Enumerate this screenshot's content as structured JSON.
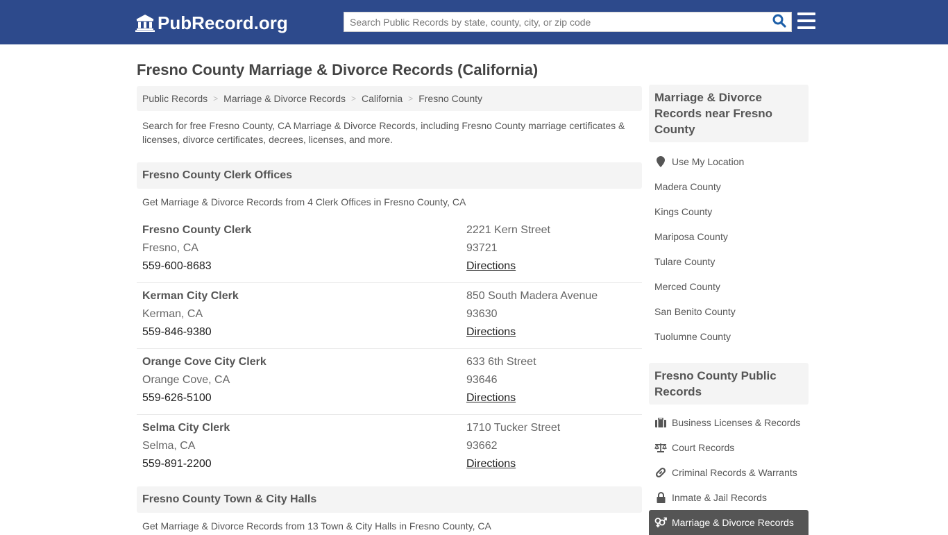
{
  "header": {
    "logo_text": "PubRecord.org",
    "search_placeholder": "Search Public Records by state, county, city, or zip code",
    "search_value": "",
    "colors": {
      "topbar": "#2d4a8c",
      "search_icon": "#1d5fa8"
    }
  },
  "page": {
    "title": "Fresno County Marriage & Divorce Records (California)",
    "breadcrumb": [
      "Public Records",
      "Marriage & Divorce Records",
      "California",
      "Fresno County"
    ],
    "breadcrumb_separator": ">",
    "intro": "Search for free Fresno County, CA Marriage & Divorce Records, including Fresno County marriage certificates & licenses, divorce certificates, decrees, licenses, and more."
  },
  "clerk_section": {
    "heading": "Fresno County Clerk Offices",
    "subheading": "Get Marriage & Divorce Records from 4 Clerk Offices in Fresno County, CA",
    "offices": [
      {
        "name": "Fresno County Clerk",
        "city": "Fresno, CA",
        "phone": "559-600-8683",
        "street": "2221 Kern Street",
        "zip": "93721",
        "directions": "Directions"
      },
      {
        "name": "Kerman City Clerk",
        "city": "Kerman, CA",
        "phone": "559-846-9380",
        "street": "850 South Madera Avenue",
        "zip": "93630",
        "directions": "Directions"
      },
      {
        "name": "Orange Cove City Clerk",
        "city": "Orange Cove, CA",
        "phone": "559-626-5100",
        "street": "633 6th Street",
        "zip": "93646",
        "directions": "Directions"
      },
      {
        "name": "Selma City Clerk",
        "city": "Selma, CA",
        "phone": "559-891-2200",
        "street": "1710 Tucker Street",
        "zip": "93662",
        "directions": "Directions"
      }
    ]
  },
  "hall_section": {
    "heading": "Fresno County Town & City Halls",
    "subheading": "Get Marriage & Divorce Records from 13 Town & City Halls in Fresno County, CA"
  },
  "sidebar": {
    "nearby_heading": "Marriage & Divorce Records near Fresno County",
    "use_location": {
      "label": "Use My Location",
      "icon": "map-marker-icon"
    },
    "nearby": [
      "Madera County",
      "Kings County",
      "Mariposa County",
      "Tulare County",
      "Merced County",
      "San Benito County",
      "Tuolumne County"
    ],
    "public_heading": "Fresno County Public Records",
    "public_records": [
      {
        "label": "Business Licenses & Records",
        "icon": "briefcase-icon",
        "active": false
      },
      {
        "label": "Court Records",
        "icon": "balance-scale-icon",
        "active": false
      },
      {
        "label": "Criminal Records & Warrants",
        "icon": "link-icon",
        "active": false
      },
      {
        "label": "Inmate & Jail Records",
        "icon": "lock-icon",
        "active": false
      },
      {
        "label": "Marriage & Divorce Records",
        "icon": "venus-mars-icon",
        "active": true
      }
    ]
  }
}
